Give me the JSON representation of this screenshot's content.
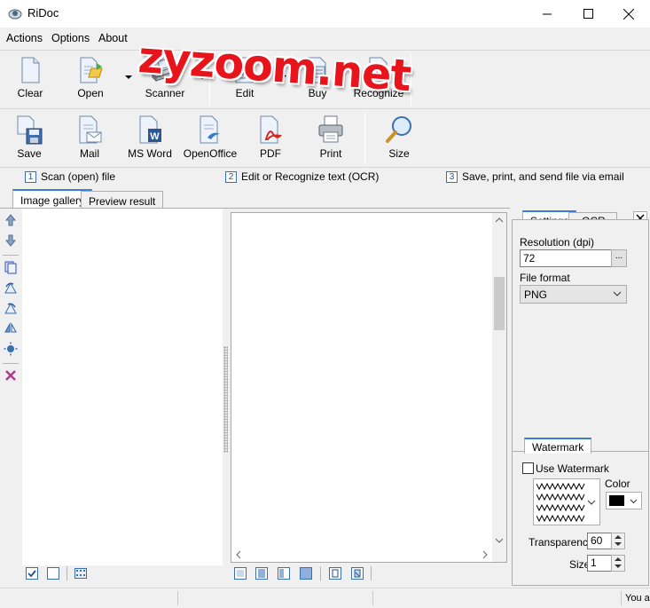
{
  "window": {
    "title": "RiDoc"
  },
  "menu": [
    "Actions",
    "Options",
    "About"
  ],
  "toolbar1": {
    "clear": "Clear",
    "open": "Open",
    "scanner": "Scanner",
    "edit": "Edit",
    "buy": "Buy",
    "recognize": "Recognize"
  },
  "toolbar2": {
    "save": "Save",
    "mail": "Mail",
    "msword": "MS Word",
    "openoffice": "OpenOffice",
    "pdf": "PDF",
    "print": "Print",
    "size": "Size"
  },
  "steps": [
    {
      "num": "1",
      "label": "Scan (open) file"
    },
    {
      "num": "2",
      "label": "Edit or Recognize text (OCR)"
    },
    {
      "num": "3",
      "label": "Save, print, and send file via email"
    }
  ],
  "tabs": {
    "gallery": "Image gallery",
    "preview": "Preview result"
  },
  "overlay_text": "zyzoom.net",
  "settings_panel": {
    "tab_settings": "Settings",
    "tab_ocr": "OCR",
    "resolution_label": "Resolution (dpi)",
    "resolution_value": "72",
    "browse_label": "...",
    "format_label": "File format",
    "format_value": "PNG",
    "watermark_tab": "Watermark",
    "use_watermark": "Use Watermark",
    "color_label": "Color",
    "transparency_label": "Transparency",
    "transparency_value": "60",
    "size_label": "Size",
    "size_value": "1"
  },
  "status": {
    "right_text": "You a"
  },
  "colors": {
    "accent": "#3c7fd1",
    "overlay": "#e8141c"
  }
}
